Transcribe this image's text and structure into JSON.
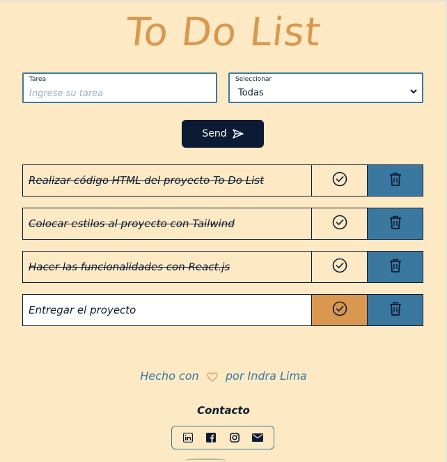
{
  "header": {
    "title": "To Do List"
  },
  "form": {
    "task_label": "Tarea",
    "task_placeholder": "Ingrese su tarea",
    "filter_label": "Seleccionar",
    "filter_value": "Todas",
    "send_label": "Send"
  },
  "tasks": [
    {
      "text": "Realizar código HTML del proyecto To Do List",
      "done": true
    },
    {
      "text": "Colocar estilos al proyecto con Tailwind",
      "done": true
    },
    {
      "text": "Hacer las funcionalidades con React.js",
      "done": true
    },
    {
      "text": "Entregar el proyecto",
      "done": false
    }
  ],
  "footer": {
    "made_prefix": "Hecho con",
    "made_suffix": "por Indra Lima",
    "contact_title": "Contacto",
    "social_icons": [
      "linkedin-icon",
      "facebook-icon",
      "instagram-icon",
      "mail-icon"
    ]
  },
  "colors": {
    "background": "#fde9c4",
    "accent_orange": "#d9974f",
    "accent_blue": "#3b78a0",
    "navy": "#0b1b33"
  }
}
